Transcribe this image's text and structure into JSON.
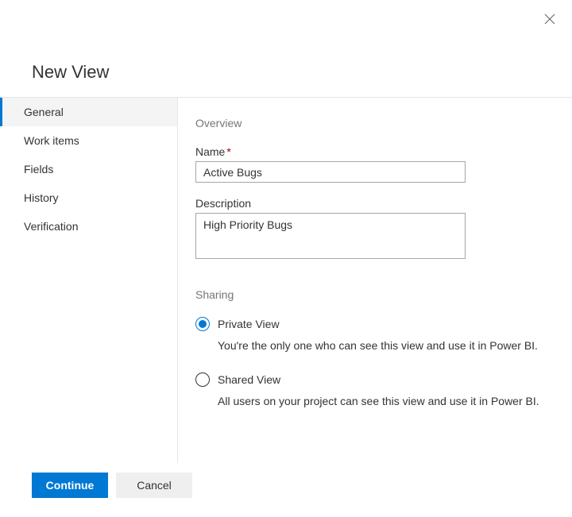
{
  "header": {
    "title": "New View"
  },
  "sidebar": {
    "items": [
      {
        "label": "General"
      },
      {
        "label": "Work items"
      },
      {
        "label": "Fields"
      },
      {
        "label": "History"
      },
      {
        "label": "Verification"
      }
    ]
  },
  "overview": {
    "section_label": "Overview",
    "name_label": "Name",
    "name_value": "Active Bugs",
    "description_label": "Description",
    "description_value": "High Priority Bugs"
  },
  "sharing": {
    "section_label": "Sharing",
    "private": {
      "label": "Private View",
      "desc": "You're the only one who can see this view and use it in Power BI."
    },
    "shared": {
      "label": "Shared View",
      "desc": "All users on your project can see this view and use it in Power BI."
    }
  },
  "footer": {
    "continue_label": "Continue",
    "cancel_label": "Cancel"
  }
}
